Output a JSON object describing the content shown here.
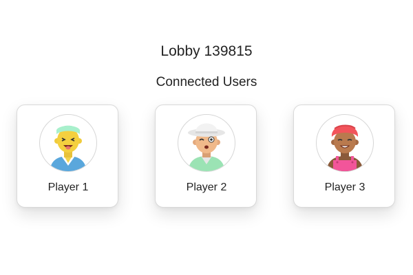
{
  "lobby": {
    "title": "Lobby 139815",
    "section_title": "Connected Users"
  },
  "players": [
    {
      "name": "Player 1",
      "avatar": "avatar-yellow-headband-icon"
    },
    {
      "name": "Player 2",
      "avatar": "avatar-white-hat-winking-icon"
    },
    {
      "name": "Player 3",
      "avatar": "avatar-red-turban-icon"
    }
  ],
  "colors": {
    "card_border": "#d9d9d9",
    "text": "#222222",
    "background": "#ffffff"
  }
}
